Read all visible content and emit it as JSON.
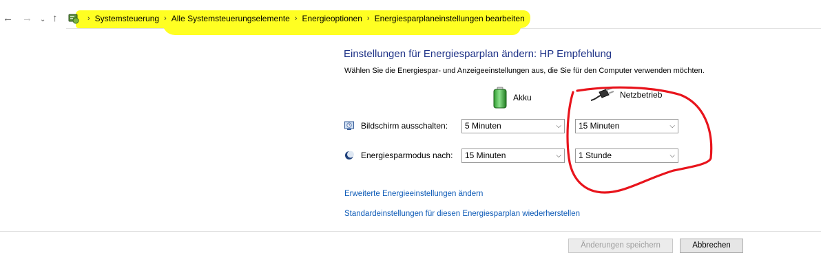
{
  "nav": {
    "back": "←",
    "forward": "→",
    "recent": "⌄",
    "up": "↑"
  },
  "breadcrumb": [
    "Systemsteuerung",
    "Alle Systemsteuerungselemente",
    "Energieoptionen",
    "Energiesparplaneinstellungen bearbeiten"
  ],
  "main": {
    "title": "Einstellungen für Energiesparplan ändern: HP Empfehlung",
    "subtitle": "Wählen Sie die Energiespar- und Anzeigeeinstellungen aus, die Sie für den Computer verwenden möchten.",
    "columns": {
      "battery": "Akku",
      "plugged": "Netzbetrieb"
    },
    "rows": [
      {
        "label": "Bildschirm ausschalten:",
        "battery_value": "5 Minuten",
        "plugged_value": "15 Minuten"
      },
      {
        "label": "Energiesparmodus nach:",
        "battery_value": "15 Minuten",
        "plugged_value": "1 Stunde"
      }
    ],
    "links": {
      "advanced": "Erweiterte Energieeinstellungen ändern",
      "restore": "Standardeinstellungen für diesen Energiesparplan wiederherstellen"
    }
  },
  "footer": {
    "save": "Änderungen speichern",
    "cancel": "Abbrechen"
  },
  "colors": {
    "highlight": "#ffff22",
    "title": "#1e3287",
    "link": "#0f5cb8",
    "annotation": "#e8141c"
  }
}
